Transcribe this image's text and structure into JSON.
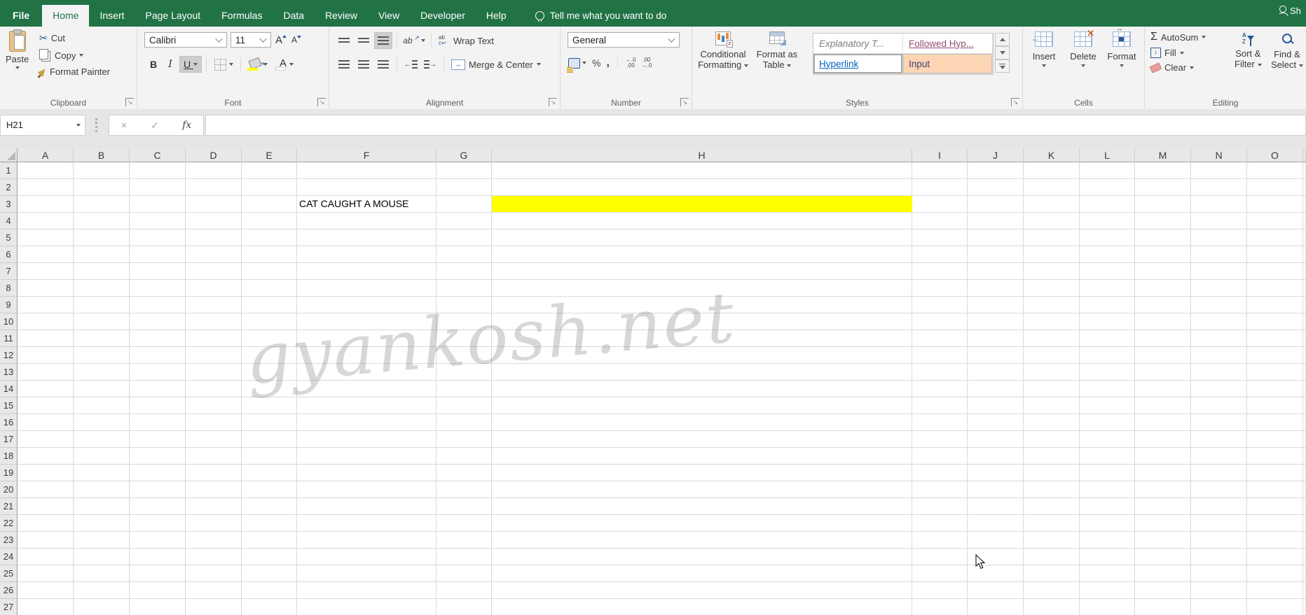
{
  "tabbar": {
    "tabs": [
      "File",
      "Home",
      "Insert",
      "Page Layout",
      "Formulas",
      "Data",
      "Review",
      "View",
      "Developer",
      "Help"
    ],
    "active_tab": "Home",
    "tell_me": "Tell me what you want to do",
    "share": "Sh"
  },
  "ribbon": {
    "group_labels": {
      "clipboard": "Clipboard",
      "font": "Font",
      "alignment": "Alignment",
      "number": "Number",
      "styles": "Styles",
      "cells": "Cells",
      "editing": "Editing"
    },
    "clipboard": {
      "paste": "Paste",
      "cut": "Cut",
      "copy": "Copy",
      "format_painter": "Format Painter"
    },
    "font": {
      "family": "Calibri",
      "size": "11",
      "bold": "B",
      "italic": "I",
      "underline": "U",
      "grow": "A",
      "shrink": "A",
      "font_color": "A"
    },
    "alignment": {
      "orientation": "ab",
      "wrap_line1": "ab",
      "wrap_line2": "c",
      "wrap_text": "Wrap Text",
      "merge_center": "Merge & Center"
    },
    "number": {
      "format": "General",
      "percent": "%",
      "comma": ",",
      "inc_top": ".0",
      "inc_bot": ".00",
      "dec_top": ".00",
      "dec_bot": ".0"
    },
    "styles": {
      "conditional_line1": "Conditional",
      "conditional_line2": "Formatting",
      "format_table_line1": "Format as",
      "format_table_line2": "Table",
      "not_equal": "≠",
      "gallery": [
        {
          "label": "Explanatory T..."
        },
        {
          "label": "Followed Hyp..."
        },
        {
          "label": "Hyperlink"
        },
        {
          "label": "Input"
        }
      ]
    },
    "cells": {
      "insert": "Insert",
      "delete": "Delete",
      "format": "Format"
    },
    "editing": {
      "autosum_icon": "Σ",
      "autosum": "AutoSum",
      "fill": "Fill",
      "clear": "Clear",
      "sort_a": "A",
      "sort_z": "Z",
      "sort_line1": "Sort &",
      "sort_line2": "Filter",
      "find_line1": "Find &",
      "find_line2": "Select"
    }
  },
  "formula_bar": {
    "name_box": "H21",
    "cancel": "×",
    "enter": "✓",
    "fx": "fx",
    "formula": ""
  },
  "grid": {
    "columns": [
      "A",
      "B",
      "C",
      "D",
      "E",
      "F",
      "G",
      "H",
      "I",
      "J",
      "K",
      "L",
      "M",
      "N",
      "O"
    ],
    "row_numbers": [
      1,
      2,
      3,
      4,
      5,
      6,
      7,
      8,
      9,
      10,
      11,
      12,
      13,
      14,
      15,
      16,
      17,
      18,
      19,
      20,
      21,
      22,
      23,
      24,
      25,
      26,
      27
    ],
    "cells": {
      "F3": {
        "text": "CAT CAUGHT A MOUSE"
      },
      "H3": {
        "fill": "#FFFF00"
      }
    }
  },
  "watermark": "gyankosh.net",
  "colors": {
    "accent_green": "#217346",
    "highlight_yellow": "#FFFF00",
    "input_style_bg": "#FCD5B4",
    "hyperlink_blue": "#0563C1",
    "followed_plum": "#954F72"
  }
}
